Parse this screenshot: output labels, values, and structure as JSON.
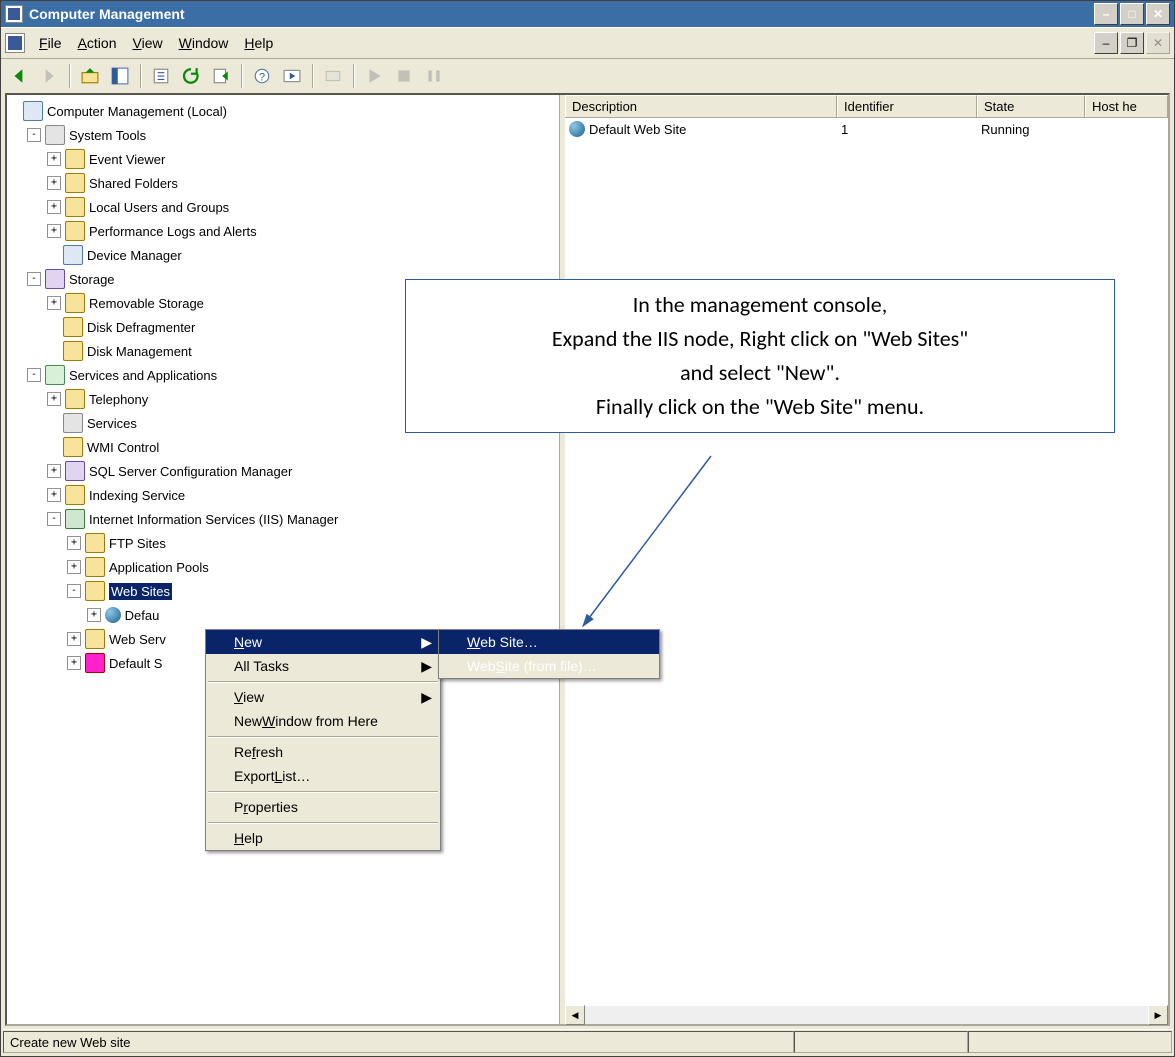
{
  "window": {
    "title": "Computer Management"
  },
  "menubar": [
    "File",
    "Action",
    "View",
    "Window",
    "Help"
  ],
  "columns": {
    "c1": "Description",
    "c2": "Identifier",
    "c3": "State",
    "c4": "Host he"
  },
  "listrow": {
    "desc": "Default Web Site",
    "id": "1",
    "state": "Running"
  },
  "tree": {
    "root": "Computer Management (Local)",
    "t1": "System Tools",
    "t1a": "Event Viewer",
    "t1b": "Shared Folders",
    "t1c": "Local Users and Groups",
    "t1d": "Performance Logs and Alerts",
    "t1e": "Device Manager",
    "t2": "Storage",
    "t2a": "Removable Storage",
    "t2b": "Disk Defragmenter",
    "t2c": "Disk Management",
    "t3": "Services and Applications",
    "t3a": "Telephony",
    "t3b": "Services",
    "t3c": "WMI Control",
    "t3d": "SQL Server Configuration Manager",
    "t3e": "Indexing Service",
    "t3f": "Internet Information Services (IIS) Manager",
    "t3f1": "FTP Sites",
    "t3f2": "Application Pools",
    "t3f3": "Web Sites",
    "t3f3a": "Defau",
    "t3f4": "Web Serv",
    "t3f5": "Default S"
  },
  "ctx": {
    "new": "New",
    "alltasks": "All Tasks",
    "view": "View",
    "newwin": "New Window from Here",
    "refresh": "Refresh",
    "export": "Export List…",
    "props": "Properties",
    "help": "Help"
  },
  "sub": {
    "ws": "Web Site…",
    "wsf": "Web Site (from file)…"
  },
  "status": "Create new Web site",
  "annot_l1": "In the management console,",
  "annot_l2": "Expand the IIS node, Right click on \"Web Sites\"",
  "annot_l3": "and select \"New\".",
  "annot_l4": "Finally click on the \"Web Site\" menu."
}
